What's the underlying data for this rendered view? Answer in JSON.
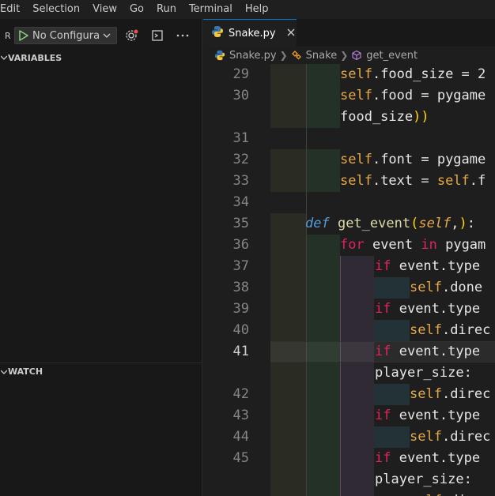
{
  "menu": [
    "Edit",
    "Selection",
    "View",
    "Go",
    "Run",
    "Terminal",
    "Help"
  ],
  "debug": {
    "run_letter": "R",
    "configuration": "No Configurati",
    "sections": {
      "variables": "VARIABLES",
      "watch": "WATCH"
    }
  },
  "editor": {
    "tab": {
      "label": "Snake.py"
    },
    "breadcrumb": [
      "Snake.py",
      "Snake",
      "get_event"
    ],
    "lines": [
      {
        "n": "29",
        "tokens": [
          [
            "self",
            "self"
          ],
          [
            ".food_size = 2",
            "w"
          ]
        ]
      },
      {
        "n": "30",
        "tokens": [
          [
            "self",
            "self"
          ],
          [
            ".food = pygame",
            "w"
          ]
        ]
      },
      {
        "n": "",
        "tokens": [
          [
            "food_size",
            "w"
          ],
          [
            "))",
            "par"
          ]
        ]
      },
      {
        "n": "31",
        "tokens": []
      },
      {
        "n": "32",
        "tokens": [
          [
            "self",
            "self"
          ],
          [
            ".font = pygame",
            "w"
          ]
        ]
      },
      {
        "n": "33",
        "tokens": [
          [
            "self",
            "self"
          ],
          [
            ".text = ",
            "w"
          ],
          [
            "self",
            "self"
          ],
          [
            ".f",
            "w"
          ]
        ]
      },
      {
        "n": "34",
        "tokens": []
      },
      {
        "n": "35",
        "tokens": [
          [
            "def ",
            "def"
          ],
          [
            "get_event",
            "fn"
          ],
          [
            "(",
            "par"
          ],
          [
            "self",
            "ital"
          ],
          [
            ",",
            "w"
          ],
          [
            ")",
            "par"
          ],
          [
            ":",
            "w"
          ]
        ]
      },
      {
        "n": "36",
        "tokens": [
          [
            "for ",
            "pink"
          ],
          [
            "event ",
            "w"
          ],
          [
            "in ",
            "pink"
          ],
          [
            "pygam",
            "w"
          ]
        ]
      },
      {
        "n": "37",
        "tokens": [
          [
            "if ",
            "pink"
          ],
          [
            "event.type",
            "w"
          ]
        ]
      },
      {
        "n": "38",
        "tokens": [
          [
            "self",
            "self"
          ],
          [
            ".done",
            "w"
          ]
        ]
      },
      {
        "n": "39",
        "tokens": [
          [
            "if ",
            "pink"
          ],
          [
            "event.type",
            "w"
          ]
        ]
      },
      {
        "n": "40",
        "tokens": [
          [
            "self",
            "self"
          ],
          [
            ".direc",
            "w"
          ]
        ]
      },
      {
        "n": "41",
        "tokens": [
          [
            "if ",
            "pink"
          ],
          [
            "event.type",
            "w"
          ]
        ]
      },
      {
        "n": "",
        "tokens": [
          [
            "player_size:",
            "w"
          ]
        ]
      },
      {
        "n": "42",
        "tokens": [
          [
            "self",
            "self"
          ],
          [
            ".direc",
            "w"
          ]
        ]
      },
      {
        "n": "43",
        "tokens": [
          [
            "if ",
            "pink"
          ],
          [
            "event.type",
            "w"
          ]
        ]
      },
      {
        "n": "44",
        "tokens": [
          [
            "self",
            "self"
          ],
          [
            ".direc",
            "w"
          ]
        ]
      },
      {
        "n": "45",
        "tokens": [
          [
            "if ",
            "pink"
          ],
          [
            "event.type",
            "w"
          ]
        ]
      },
      {
        "n": "",
        "tokens": [
          [
            "player_size:",
            "w"
          ]
        ]
      },
      {
        "n": "",
        "tokens": [
          [
            "self",
            "self"
          ],
          [
            ".direc",
            "w"
          ]
        ]
      }
    ]
  },
  "colors": {
    "tab_accent": "#0078d4",
    "run_green": "#89d185"
  }
}
